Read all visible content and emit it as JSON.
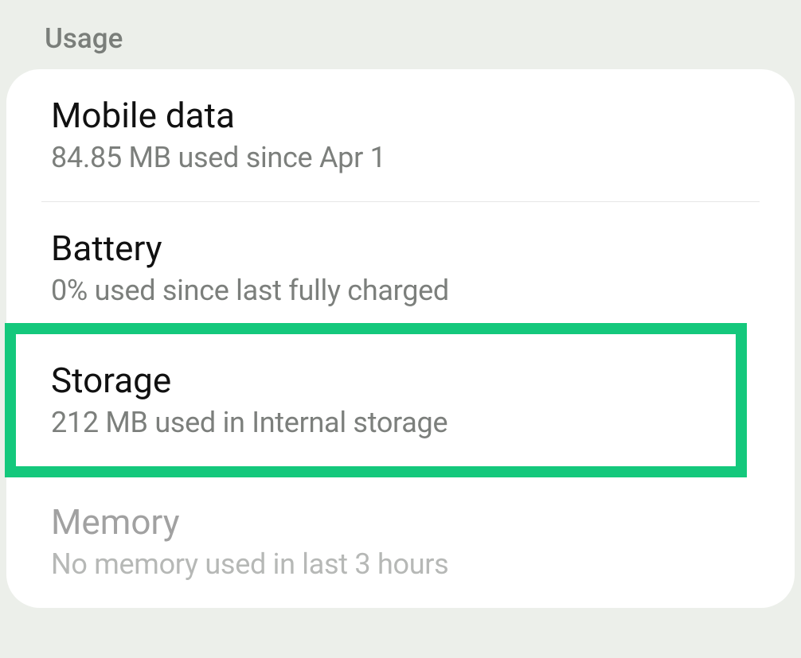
{
  "section": {
    "title": "Usage"
  },
  "items": [
    {
      "title": "Mobile data",
      "subtitle": "84.85 MB used since Apr 1"
    },
    {
      "title": "Battery",
      "subtitle": "0% used since last fully charged"
    },
    {
      "title": "Storage",
      "subtitle": "212 MB used in Internal storage"
    },
    {
      "title": "Memory",
      "subtitle": "No memory used in last 3 hours"
    }
  ]
}
